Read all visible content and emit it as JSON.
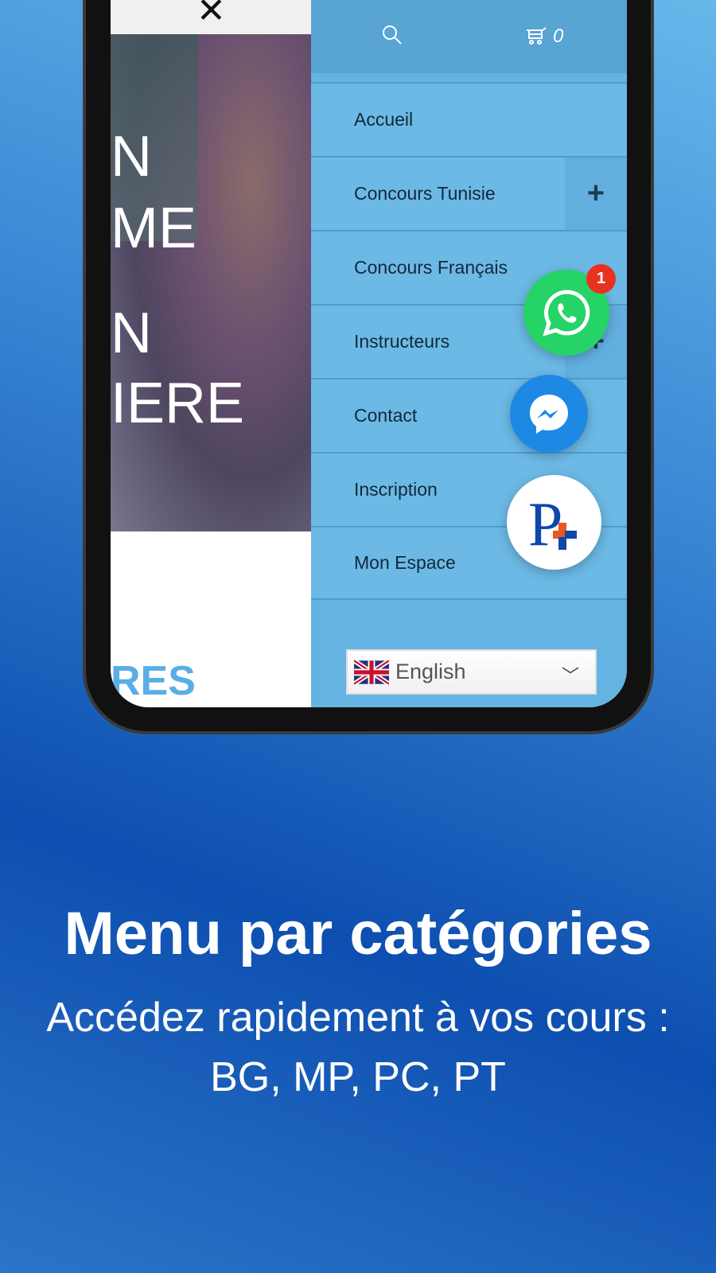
{
  "hero": {
    "lines": [
      "N",
      "ME",
      "N",
      "IERE"
    ],
    "bottom_text": "RES"
  },
  "menu": {
    "cart_count": "0",
    "items": [
      {
        "label": "Accueil",
        "expandable": false
      },
      {
        "label": "Concours Tunisie",
        "expandable": true
      },
      {
        "label": "Concours Français",
        "expandable": false
      },
      {
        "label": "Instructeurs",
        "expandable": true
      },
      {
        "label": "Contact",
        "expandable": false
      },
      {
        "label": "Inscription",
        "expandable": false
      },
      {
        "label": "Mon Espace",
        "expandable": false
      }
    ],
    "expand_symbol": "+",
    "language": "English"
  },
  "floating": {
    "whatsapp_badge": "1"
  },
  "caption": {
    "title": "Menu par catégories",
    "subtitle_line1": "Accédez rapidement à vos cours :",
    "subtitle_line2": "BG, MP, PC, PT"
  },
  "colors": {
    "menu": "#6cb9e6",
    "whatsapp": "#25d366",
    "messenger": "#1e88e5",
    "badge": "#e8321f"
  }
}
